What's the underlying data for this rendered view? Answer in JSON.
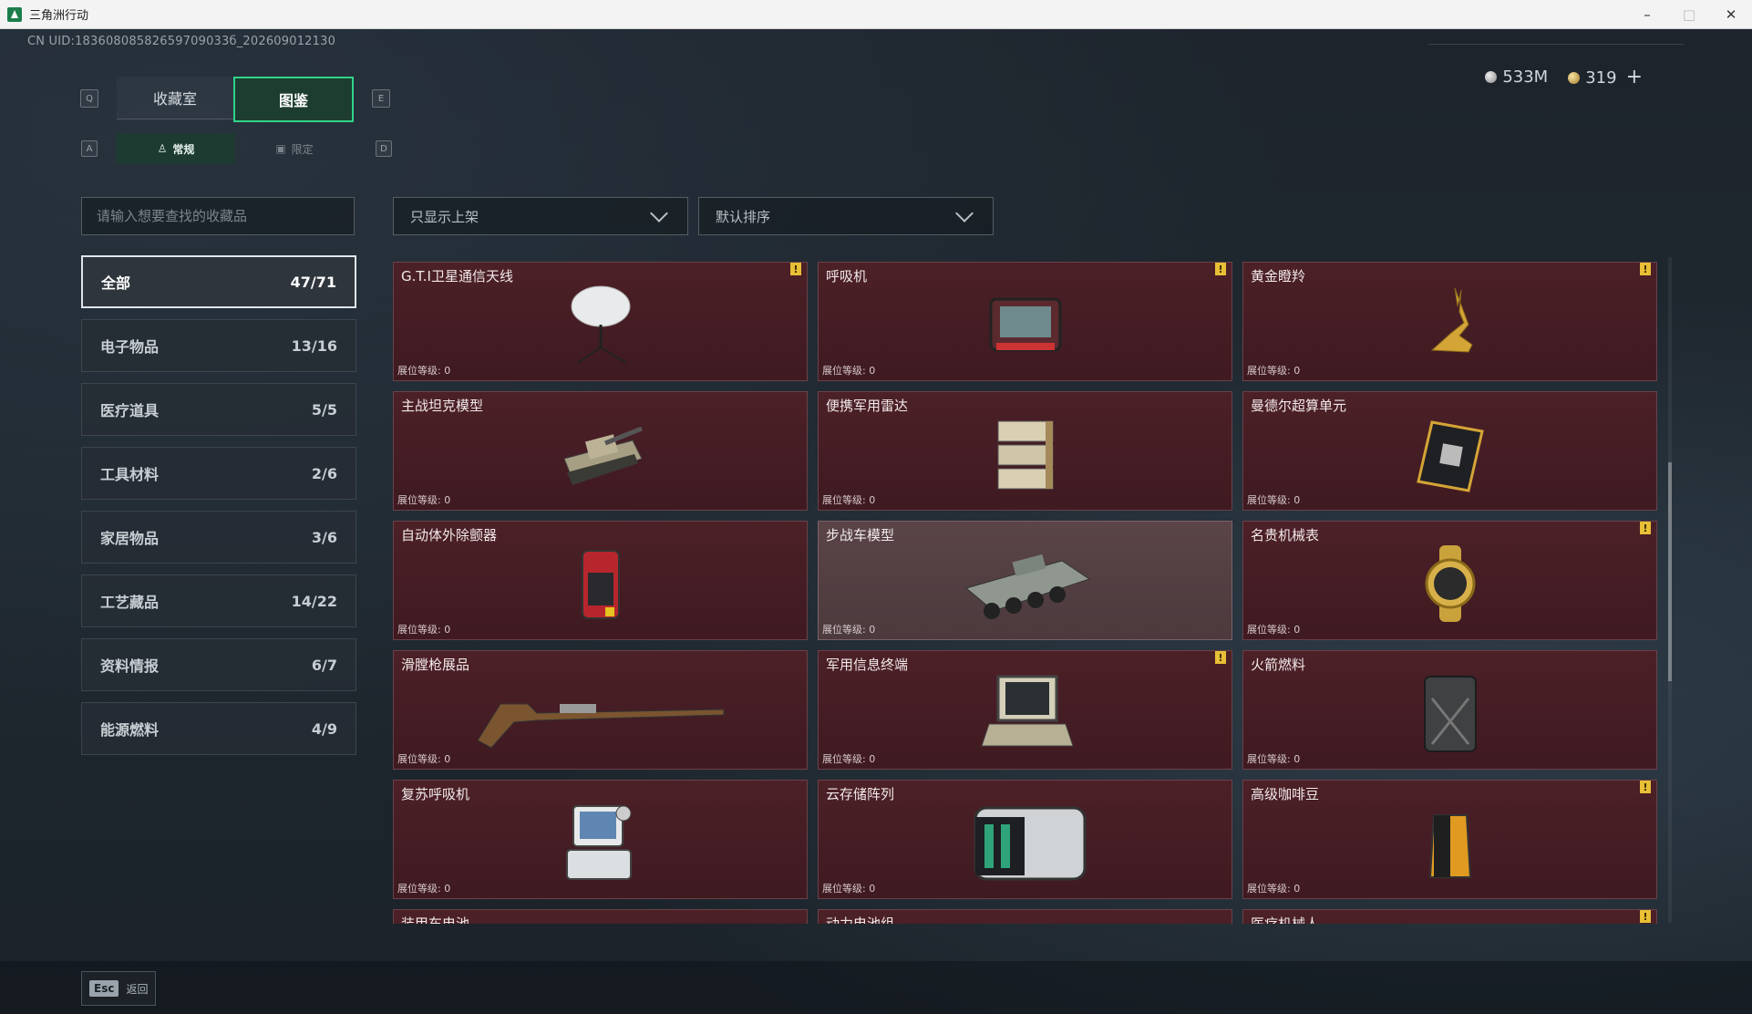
{
  "window": {
    "title": "三角洲行动",
    "min": "–",
    "max": "□",
    "close": "✕"
  },
  "uid": "CN UID:18360808582659709033б_202609012130",
  "currency": {
    "silver": "533M",
    "gold": "319",
    "plus": "+"
  },
  "keys": {
    "q": "Q",
    "e": "E",
    "a": "A",
    "d": "D"
  },
  "tabs": [
    {
      "label": "收藏室"
    },
    {
      "label": "图鉴"
    }
  ],
  "subtabs": [
    {
      "label": "常规"
    },
    {
      "label": "限定"
    }
  ],
  "search": {
    "placeholder": "请输入想要查找的收藏品"
  },
  "filters": {
    "shelf": "只显示上架",
    "sort": "默认排序"
  },
  "categories": [
    {
      "label": "全部",
      "count": "47/71"
    },
    {
      "label": "电子物品",
      "count": "13/16"
    },
    {
      "label": "医疗道具",
      "count": "5/5"
    },
    {
      "label": "工具材料",
      "count": "2/6"
    },
    {
      "label": "家居物品",
      "count": "3/6"
    },
    {
      "label": "工艺藏品",
      "count": "14/22"
    },
    {
      "label": "资料情报",
      "count": "6/7"
    },
    {
      "label": "能源燃料",
      "count": "4/9"
    }
  ],
  "level_label": "展位等级: 0",
  "badge": "!",
  "items": [
    {
      "name": "G.T.I卫星通信天线"
    },
    {
      "name": "呼吸机"
    },
    {
      "name": "黄金瞪羚"
    },
    {
      "name": "主战坦克模型"
    },
    {
      "name": "便携军用雷达"
    },
    {
      "name": "曼德尔超算单元"
    },
    {
      "name": "自动体外除颤器"
    },
    {
      "name": "步战车模型"
    },
    {
      "name": "名贵机械表"
    },
    {
      "name": "滑膛枪展品"
    },
    {
      "name": "军用信息终端"
    },
    {
      "name": "火箭燃料"
    },
    {
      "name": "复苏呼吸机"
    },
    {
      "name": "云存储阵列"
    },
    {
      "name": "高级咖啡豆"
    },
    {
      "name": "装甲车电池"
    },
    {
      "name": "动力电池组"
    },
    {
      "name": "医疗机械人"
    }
  ],
  "footer": {
    "esc": "Esc",
    "back": "返回"
  }
}
